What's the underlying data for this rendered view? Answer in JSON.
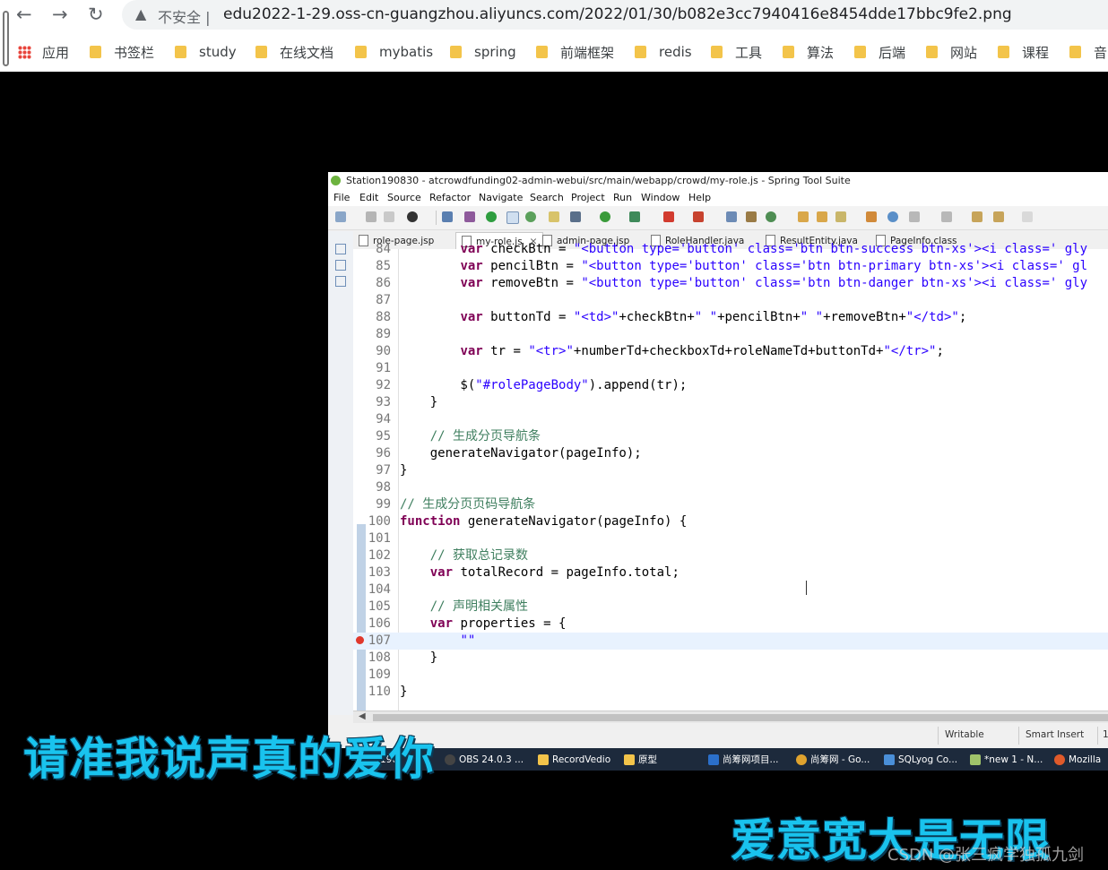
{
  "browser": {
    "insecure_label": "不安全 |",
    "url": "edu2022-1-29.oss-cn-guangzhou.aliyuncs.com/2022/01/30/b082e3cc7940416e8454dde17bbc9fe2.png",
    "bookmarks": [
      "应用",
      "书签栏",
      "study",
      "在线文档",
      "mybatis",
      "spring",
      "前端框架",
      "redis",
      "工具",
      "算法",
      "后端",
      "网站",
      "课程",
      "音"
    ]
  },
  "ide": {
    "title": "Station190830 - atcrowdfunding02-admin-webui/src/main/webapp/crowd/my-role.js - Spring Tool Suite",
    "menu": [
      "File",
      "Edit",
      "Source",
      "Refactor",
      "Navigate",
      "Search",
      "Project",
      "Run",
      "Window",
      "Help"
    ],
    "tabs": [
      "role-page.jsp",
      "my-role.js",
      "admin-page.jsp",
      "RoleHandler.java",
      "ResultEntity.java",
      "PageInfo.class"
    ],
    "lines": [
      {
        "n": "84",
        "t": "        var checkBtn = \"<button type='button' class='btn btn-success btn-xs'><i class=' gly"
      },
      {
        "n": "85",
        "t": "        var pencilBtn = \"<button type='button' class='btn btn-primary btn-xs'><i class=' gl"
      },
      {
        "n": "86",
        "t": "        var removeBtn = \"<button type='button' class='btn btn-danger btn-xs'><i class=' gly"
      },
      {
        "n": "87",
        "t": ""
      },
      {
        "n": "88",
        "t": "        var buttonTd = \"<td>\"+checkBtn+\" \"+pencilBtn+\" \"+removeBtn+\"</td>\";"
      },
      {
        "n": "89",
        "t": ""
      },
      {
        "n": "90",
        "t": "        var tr = \"<tr>\"+numberTd+checkboxTd+roleNameTd+buttonTd+\"</tr>\";"
      },
      {
        "n": "91",
        "t": ""
      },
      {
        "n": "92",
        "t": "        $(\"#rolePageBody\").append(tr);"
      },
      {
        "n": "93",
        "t": "    }"
      },
      {
        "n": "94",
        "t": ""
      },
      {
        "n": "95",
        "t": "    // 生成分页导航条"
      },
      {
        "n": "96",
        "t": "    generateNavigator(pageInfo);"
      },
      {
        "n": "97",
        "t": "}"
      },
      {
        "n": "98",
        "t": ""
      },
      {
        "n": "99",
        "t": "// 生成分页页码导航条"
      },
      {
        "n": "100",
        "t": "function generateNavigator(pageInfo) {"
      },
      {
        "n": "101",
        "t": ""
      },
      {
        "n": "102",
        "t": "    // 获取总记录数"
      },
      {
        "n": "103",
        "t": "    var totalRecord = pageInfo.total;"
      },
      {
        "n": "104",
        "t": ""
      },
      {
        "n": "105",
        "t": "    // 声明相关属性"
      },
      {
        "n": "106",
        "t": "    var properties = {"
      },
      {
        "n": "107",
        "t": "        \"\""
      },
      {
        "n": "108",
        "t": "    }"
      },
      {
        "n": "109",
        "t": ""
      },
      {
        "n": "110",
        "t": "}"
      }
    ],
    "status": {
      "writable": "Writable",
      "insert_mode": "Smart Insert",
      "position": "1"
    }
  },
  "taskbar": [
    "190",
    "OBS 24.0.3 ...",
    "RecordVedio",
    "原型",
    "尚筹网项目...",
    "尚筹网 - Go...",
    "SQLyog Co...",
    "*new 1 - N...",
    "Mozilla"
  ],
  "subtitles": {
    "left": "请准我说声真的爱你",
    "right": "爱意宽大是无限"
  },
  "watermark": "CSDN @张三疯学独孤九剑",
  "colors": {
    "subtitle": "#19c3ee",
    "keyword": "#7f0055",
    "string": "#2a00ff",
    "comment": "#3f7f5f"
  }
}
